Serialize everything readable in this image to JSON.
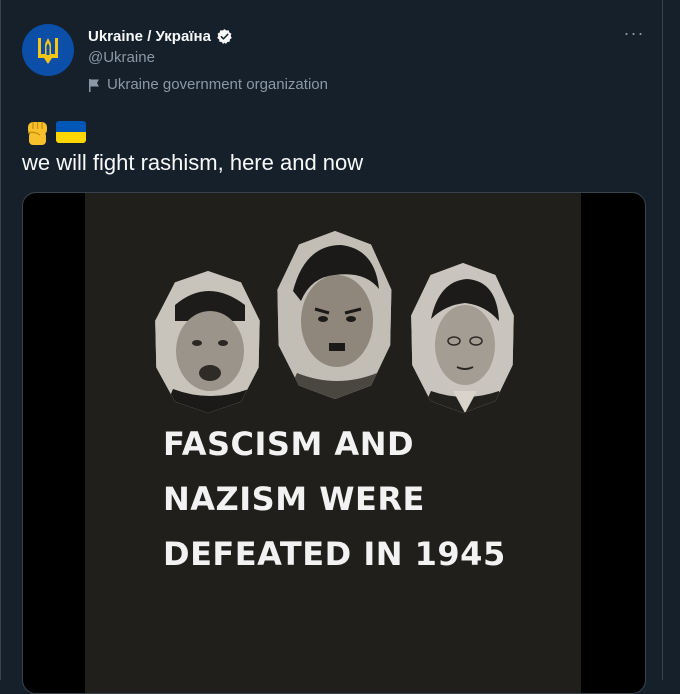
{
  "account": {
    "display_name": "Ukraine / Україна",
    "handle": "@Ukraine",
    "label": "Ukraine government organization"
  },
  "icons": {
    "avatar": "tryzub-coat-of-arms",
    "verified": "verified-badge-icon",
    "label": "flag-icon",
    "more": "more-horizontal-icon",
    "emoji_1": "raised-fist-emoji",
    "emoji_2": "ukraine-flag-emoji"
  },
  "more_glyph": "···",
  "tweet": {
    "text": "we will fight rashism, here and now"
  },
  "media": {
    "headline_lines": [
      "FASCISM AND",
      "NAZISM WERE",
      "DEFEATED IN 1945"
    ]
  },
  "colors": {
    "background": "#15202b",
    "text": "#f7f9f9",
    "secondary_text": "#8b98a5",
    "border": "#38444d",
    "ukraine_blue": "#0057b7",
    "ukraine_yellow": "#ffd700"
  }
}
